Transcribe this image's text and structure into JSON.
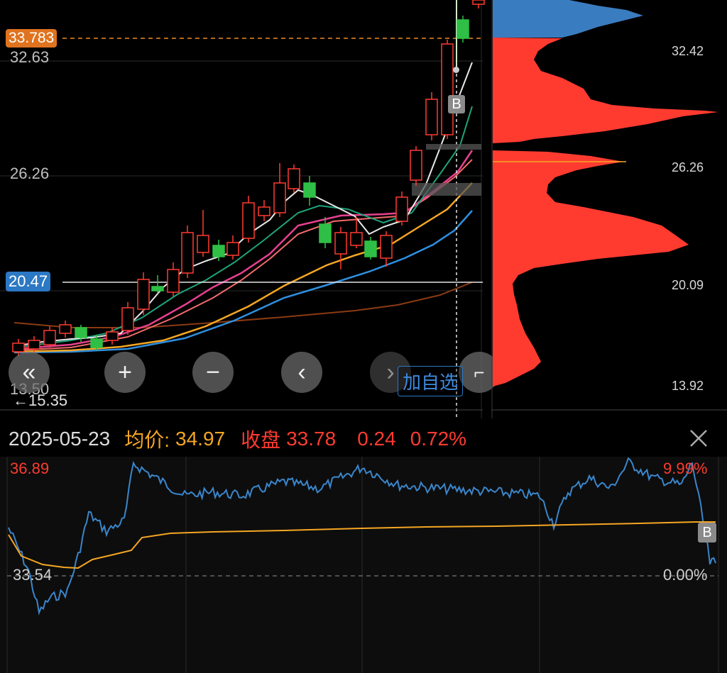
{
  "kline": {
    "current_price_tag": "33.783",
    "crosshair_price_tag": "20.47",
    "y_labels": [
      "32.63",
      "26.26",
      "13.50"
    ],
    "min_marker": "←15.35",
    "trade_marker": "B",
    "add_watchlist_label": "加自选",
    "controls": [
      "«",
      "+",
      "−",
      "‹",
      "›"
    ]
  },
  "volume_profile": {
    "labels": [
      "32.42",
      "26.26",
      "20.09",
      "13.92"
    ]
  },
  "info_bar": {
    "date": "2025-05-23",
    "avg_label": "均价:",
    "avg_value": "34.97",
    "close_label": "收盘",
    "close_value": "33.78",
    "change": "0.24",
    "change_pct": "0.72%"
  },
  "intraday": {
    "top_left": "36.89",
    "top_right": "9.99%",
    "mid_left": "33.54",
    "mid_right": "0.00%",
    "trade_marker": "B"
  },
  "colors": {
    "up": "#ff3b30",
    "down": "#2fbf46",
    "accent_orange": "#f5a623",
    "profile_blue": "#3a7cc0",
    "profile_red": "#ff3b30",
    "ma_white": "#e8e8e8",
    "ma_green": "#1fa37a",
    "ma_pink": "#e8408f",
    "ma_salmon": "#f06a6a",
    "ma_yellow": "#f5a623",
    "ma_blue": "#2f8fe0",
    "ma_brown": "#8a3a12"
  }
}
